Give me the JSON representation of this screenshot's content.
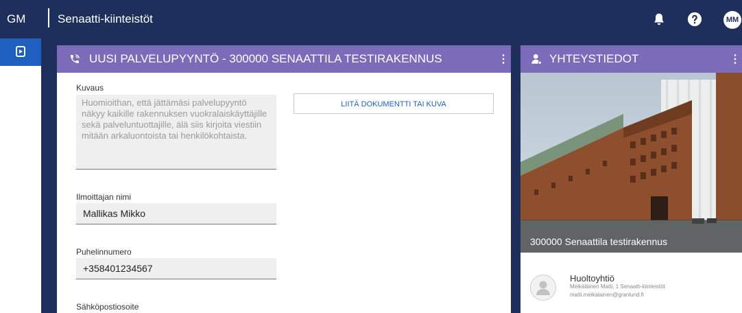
{
  "header": {
    "brand": "GM",
    "app_title": "Senaatti-kiinteistöt",
    "user_initials": "MM",
    "icons": [
      "bell-icon",
      "help-icon"
    ]
  },
  "rail": {
    "icon": "play-square-icon"
  },
  "request_card": {
    "title": "UUSI PALVELUPYYNTÖ - 300000 SENAATTILA TESTIRAKENNUS",
    "menu": "⋮",
    "icon": "phone-icon",
    "description_label": "Kuvaus",
    "description_placeholder": "Huomioithan, että jättämäsi palvelupyyntö näkyy kaikille rakennuksen vuokralaiskäyttäjille sekä palveluntuottajille, älä siis kirjoita viestiin mitään arkaluontoista tai henkilökohtaista.",
    "attach_button": "LIITÄ DOKUMENTTI TAI KUVA",
    "reporter_label": "Ilmoittajan nimi",
    "reporter_value": "Mallikas Mikko",
    "phone_label": "Puhelinnumero",
    "phone_value": "+358401234567",
    "email_label": "Sähköpostiosoite"
  },
  "contact_card": {
    "title": "YHTEYSTIEDOT",
    "menu": "⋮",
    "icon": "person-icon",
    "building_caption": "300000 Senaattila testirakennus",
    "contact_role": "Huoltoyhtiö",
    "contact_line1": "Meikäläinen Matti, 1 Senaatti-kiinteistöt",
    "contact_line2": "matti.meikalainen@granlund.fi"
  },
  "colors": {
    "topbar": "#1e2f5c",
    "card_header": "#7b6bb8",
    "accent": "#1f5fbf"
  }
}
